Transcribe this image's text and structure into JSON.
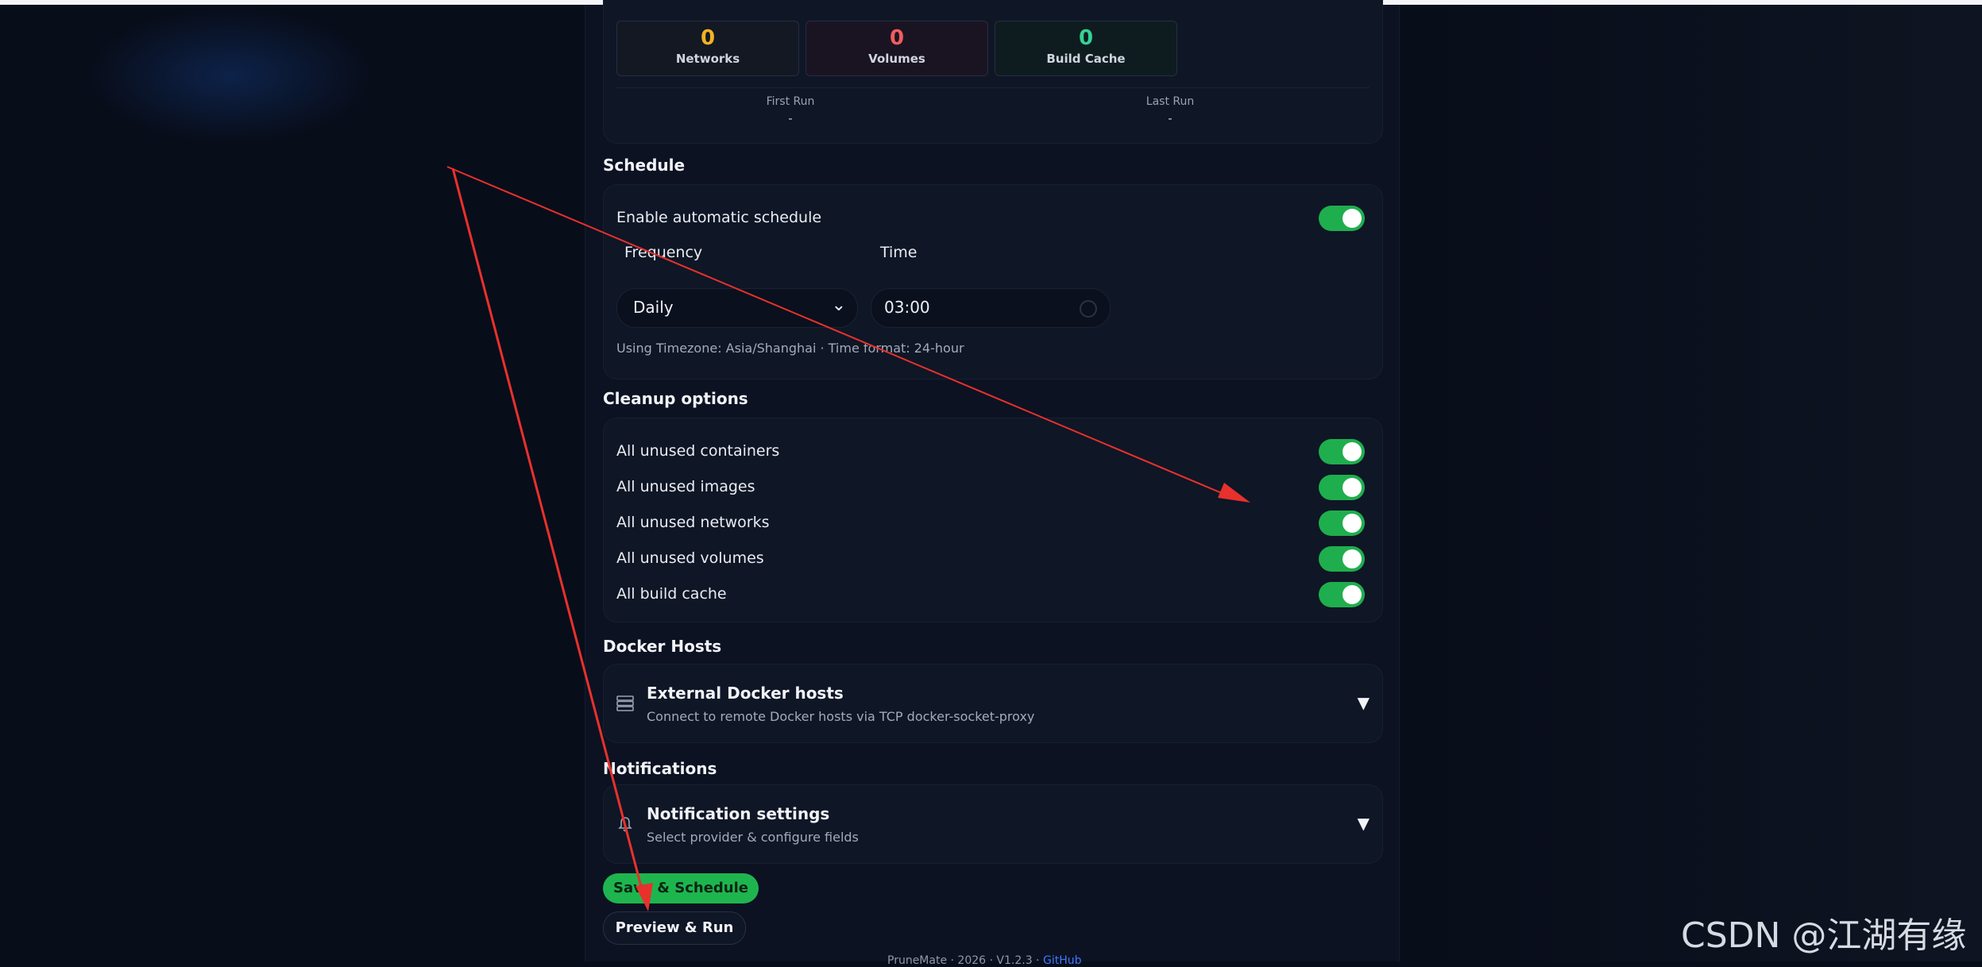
{
  "stats": [
    {
      "key": "networks",
      "value": "0",
      "label": "Networks"
    },
    {
      "key": "volumes",
      "value": "0",
      "label": "Volumes"
    },
    {
      "key": "cache",
      "value": "0",
      "label": "Build Cache"
    }
  ],
  "runs": {
    "first_label": "First Run",
    "first_value": "-",
    "last_label": "Last Run",
    "last_value": "-"
  },
  "schedule": {
    "title": "Schedule",
    "enable_label": "Enable automatic schedule",
    "enabled": true,
    "frequency_label": "Frequency",
    "frequency_value": "Daily",
    "time_label": "Time",
    "time_value": "03:00",
    "hint": "Using Timezone: Asia/Shanghai · Time format: 24-hour"
  },
  "cleanup": {
    "title": "Cleanup options",
    "options": [
      {
        "label": "All unused containers",
        "enabled": true
      },
      {
        "label": "All unused images",
        "enabled": true
      },
      {
        "label": "All unused networks",
        "enabled": true
      },
      {
        "label": "All unused volumes",
        "enabled": true
      },
      {
        "label": "All build cache",
        "enabled": true
      }
    ]
  },
  "docker_hosts": {
    "title": "Docker Hosts",
    "item_title": "External Docker hosts",
    "item_sub": "Connect to remote Docker hosts via TCP docker-socket-proxy",
    "icon": "server-icon",
    "caret": "▼"
  },
  "notifications": {
    "title": "Notifications",
    "item_title": "Notification settings",
    "item_sub": "Select provider & configure fields",
    "icon": "bell-icon",
    "caret": "▼"
  },
  "actions": {
    "save_label": "Save & Schedule",
    "preview_label": "Preview & Run"
  },
  "footer": {
    "text": "PruneMate · 2026 · V1.2.3 ·",
    "link": "GitHub"
  },
  "watermark": "CSDN @江湖有缘",
  "colors": {
    "accent_green": "#1fb54e",
    "networks": "#f2b322",
    "volumes": "#f25d5d",
    "build_cache": "#35d294",
    "annotation_arrow": "#e8312c"
  }
}
